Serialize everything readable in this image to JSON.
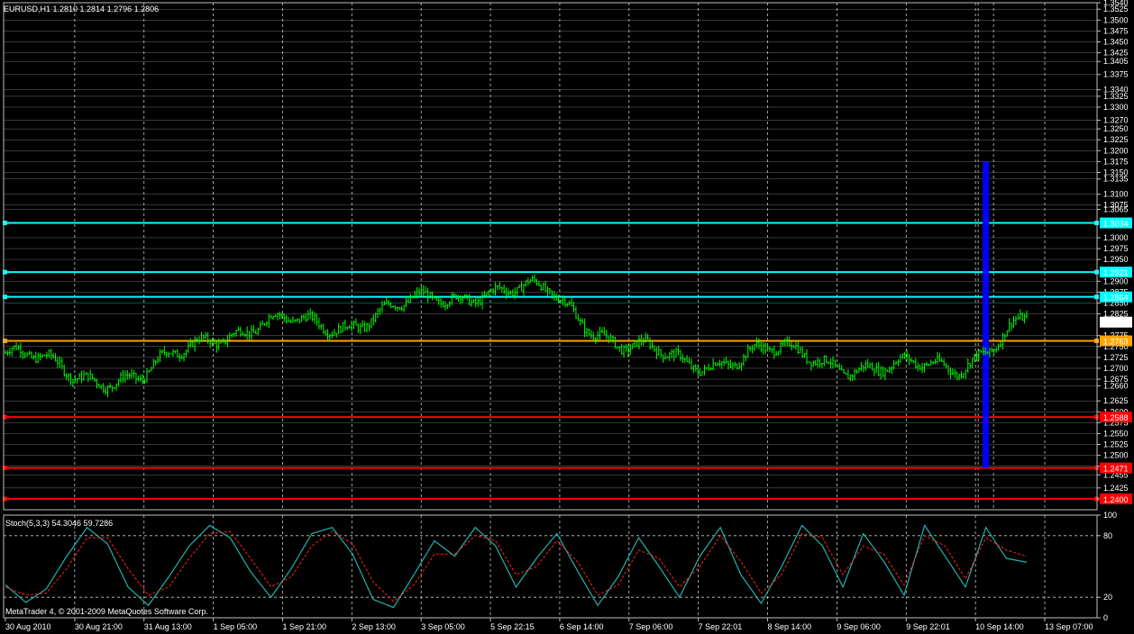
{
  "header": {
    "symbol_line": "EURUSD,H1  1.2810 1.2814 1.2796 1.2806",
    "stoch_line": "Stoch(5,3,3) 54.3046 59.7286",
    "copyright": "MetaTrader 4, © 2001-2009 MetaQuotes Software Corp."
  },
  "colors": {
    "background": "#000000",
    "grid": "#c8c8c8",
    "candle": "#00ff00",
    "cyan_line": "#00ffff",
    "orange_line": "#ffa500",
    "red_line": "#ff0000",
    "blue_bar": "#0000ff",
    "stoch_main": "#20b2aa",
    "stoch_signal": "#ff2020"
  },
  "chart_data": [
    {
      "type": "line",
      "series_label": "EURUSD,H1",
      "ylim": [
        1.2375,
        1.354
      ],
      "price_scale_labels": [
        "1.3540",
        "1.3525",
        "1.3500",
        "1.3475",
        "1.3450",
        "1.3425",
        "1.3405",
        "1.3375",
        "1.3340",
        "1.3325",
        "1.3300",
        "1.3270",
        "1.3250",
        "1.3225",
        "1.3200",
        "1.3175",
        "1.3150",
        "1.3135",
        "1.3100",
        "1.3075",
        "1.3065",
        "1.3000",
        "1.2975",
        "1.2950",
        "1.2900",
        "1.2875",
        "1.2850",
        "1.2825",
        "1.2775",
        "1.2750",
        "1.2725",
        "1.2700",
        "1.2675",
        "1.2660",
        "1.2625",
        "1.2600",
        "1.2575",
        "1.2550",
        "1.2525",
        "1.2500",
        "1.2475",
        "1.2455",
        "1.2425",
        "1.2400"
      ],
      "current_price": "1.2806",
      "horizontal_lines": [
        {
          "price": "1.3034",
          "color": "cyan"
        },
        {
          "price": "1.2921",
          "color": "cyan"
        },
        {
          "price": "1.2864",
          "color": "cyan"
        },
        {
          "price": "1.2763",
          "color": "orange"
        },
        {
          "price": "1.2588",
          "color": "red"
        },
        {
          "price": "1.2471",
          "color": "red"
        },
        {
          "price": "1.2400",
          "color": "red"
        }
      ],
      "vertical_highlight": {
        "from": 1.3175,
        "to": 1.2471
      },
      "close_path": [
        {
          "x": "30 Aug 2010",
          "y": 1.2735
        },
        {
          "x": "30 Aug 21:00",
          "y": 1.269
        },
        {
          "x": "31 Aug 13:00",
          "y": 1.2672
        },
        {
          "x": "1 Sep 05:00",
          "y": 1.278
        },
        {
          "x": "1 Sep 21:00",
          "y": 1.28
        },
        {
          "x": "2 Sep 13:00",
          "y": 1.2805
        },
        {
          "x": "3 Sep 05:00",
          "y": 1.2845
        },
        {
          "x": "5 Sep 22:15",
          "y": 1.2882
        },
        {
          "x": "6 Sep 14:00",
          "y": 1.287
        },
        {
          "x": "7 Sep 06:00",
          "y": 1.276
        },
        {
          "x": "7 Sep 22:01",
          "y": 1.2705
        },
        {
          "x": "8 Sep 14:00",
          "y": 1.274
        },
        {
          "x": "9 Sep 06:00",
          "y": 1.272
        },
        {
          "x": "9 Sep 22:01",
          "y": 1.2695
        },
        {
          "x": "10 Sep 14:00",
          "y": 1.271
        },
        {
          "x": "13 Sep 07:00",
          "y": 1.2806
        }
      ]
    },
    {
      "type": "line",
      "series_label": "Stoch(5,3,3)",
      "ylim": [
        0,
        100
      ],
      "y_ticks": [
        "100",
        "80",
        "20",
        "0"
      ],
      "levels": [
        80,
        20
      ],
      "main": [
        32,
        15,
        28,
        60,
        88,
        72,
        30,
        12,
        40,
        70,
        90,
        78,
        45,
        20,
        48,
        82,
        88,
        62,
        18,
        10,
        42,
        75,
        60,
        88,
        70,
        30,
        58,
        82,
        46,
        12,
        40,
        78,
        50,
        20,
        60,
        88,
        42,
        14,
        50,
        90,
        70,
        30,
        82,
        55,
        22,
        90,
        60,
        30,
        88,
        58,
        54
      ],
      "signal": [
        30,
        22,
        24,
        48,
        78,
        78,
        48,
        22,
        30,
        58,
        82,
        84,
        58,
        30,
        40,
        70,
        84,
        72,
        35,
        16,
        32,
        62,
        62,
        80,
        75,
        42,
        50,
        75,
        55,
        22,
        32,
        66,
        58,
        30,
        50,
        80,
        55,
        24,
        42,
        82,
        78,
        42,
        70,
        62,
        32,
        80,
        70,
        38,
        78,
        66,
        60
      ]
    }
  ],
  "time_axis": [
    "30 Aug 2010",
    "30 Aug 21:00",
    "31 Aug 13:00",
    "1 Sep 05:00",
    "1 Sep 21:00",
    "2 Sep 13:00",
    "3 Sep 05:00",
    "5 Sep 22:15",
    "6 Sep 14:00",
    "7 Sep 06:00",
    "7 Sep 22:01",
    "8 Sep 14:00",
    "9 Sep 06:00",
    "9 Sep 22:01",
    "10 Sep 14:00",
    "13 Sep 07:00"
  ]
}
